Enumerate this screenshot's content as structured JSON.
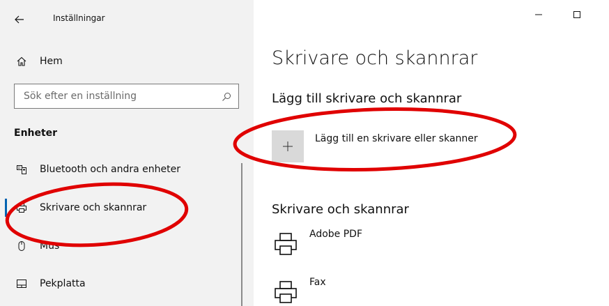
{
  "window": {
    "app_title": "Inställningar"
  },
  "sidebar": {
    "home_label": "Hem",
    "search": {
      "placeholder": "Sök efter en inställning"
    },
    "section_title": "Enheter",
    "items": [
      {
        "label": "Bluetooth och andra enheter",
        "icon": "bluetooth-devices-icon"
      },
      {
        "label": "Skrivare och skannrar",
        "icon": "printer-icon",
        "selected": true
      },
      {
        "label": "Mus",
        "icon": "mouse-icon"
      },
      {
        "label": "Pekplatta",
        "icon": "touchpad-icon"
      }
    ]
  },
  "main": {
    "page_title": "Skrivare och skannrar",
    "add_section_title": "Lägg till skrivare och skannrar",
    "add_button_label": "Lägg till en skrivare eller skanner",
    "list_title": "Skrivare och skannrar",
    "printers": [
      {
        "name": "Adobe PDF"
      },
      {
        "name": "Fax"
      }
    ]
  },
  "colors": {
    "sidebar_bg": "#f2f2f2",
    "accent": "#0063b1",
    "annotation": "#e00000"
  }
}
